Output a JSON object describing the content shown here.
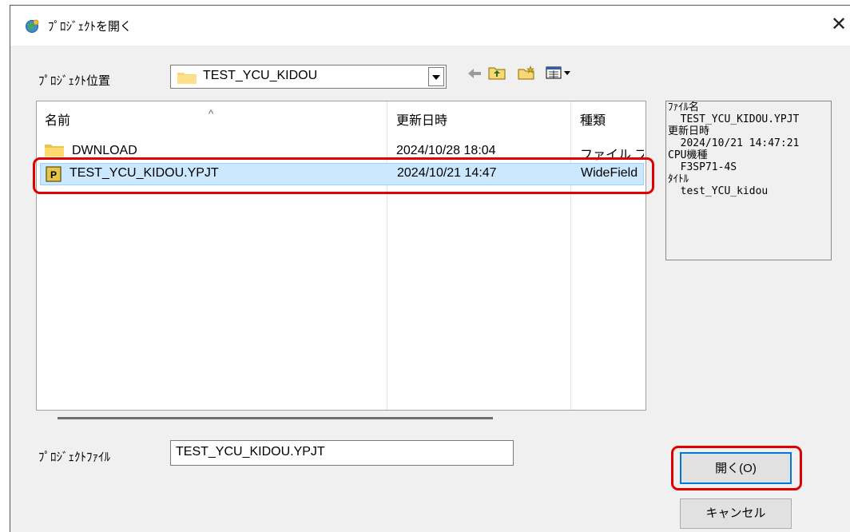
{
  "dialog": {
    "title": "ﾌﾟﾛｼﾞｪｸﾄを開く",
    "close_glyph": "✕"
  },
  "location": {
    "label": "ﾌﾟﾛｼﾞｪｸﾄ位置",
    "selected": "TEST_YCU_KIDOU"
  },
  "toolbar": {
    "back_glyph": "🡐",
    "up_glyph": "⬆",
    "newfolder_glyph": "✱",
    "view_glyph": "▦▾"
  },
  "list": {
    "columns": [
      "名前",
      "更新日時",
      "種類"
    ],
    "sort_glyph": "^",
    "rows": [
      {
        "name": "DWNLOAD",
        "date": "2024/10/28 18:04",
        "type": "ファイル フォ",
        "icon": "folder-icon"
      },
      {
        "name": "TEST_YCU_KIDOU.YPJT",
        "date": "2024/10/21 14:47",
        "type": "WideField",
        "icon": "project-file-icon"
      }
    ]
  },
  "preview": {
    "lines": [
      "ﾌｧｲﾙ名",
      "  TEST_YCU_KIDOU.YPJT",
      "更新日時",
      "  2024/10/21 14:47:21",
      "CPU機種",
      "  F3SP71-4S",
      "ﾀｲﾄﾙ",
      "  test_YCU_kidou"
    ]
  },
  "file": {
    "label": "ﾌﾟﾛｼﾞｪｸﾄﾌｧｲﾙ",
    "value": "TEST_YCU_KIDOU.YPJT"
  },
  "buttons": {
    "open": "開く(O)",
    "cancel": "キャンセル"
  },
  "colors": {
    "highlight": "#e00000",
    "selection": "#cce8ff",
    "focus": "#0078d7"
  }
}
